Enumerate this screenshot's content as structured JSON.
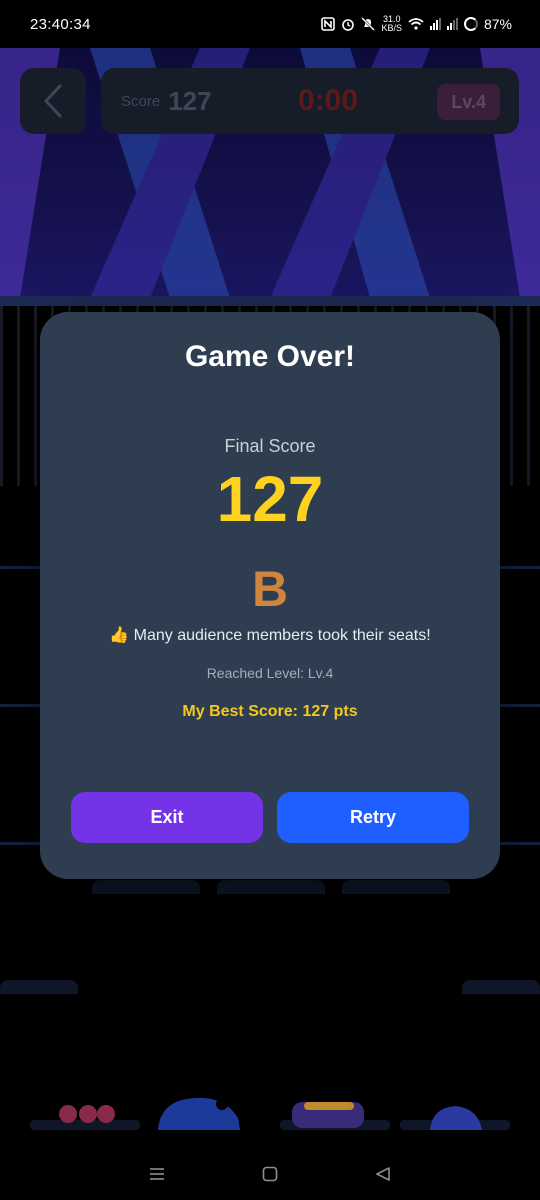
{
  "status_bar": {
    "time": "23:40:34",
    "net_speed_value": "31.0",
    "net_speed_unit": "KB/S",
    "battery": "87%",
    "icons": [
      "nfc-icon",
      "alarm-icon",
      "mute-icon",
      "wifi-icon",
      "signal-icon",
      "signal-icon",
      "battery-icon"
    ]
  },
  "hud": {
    "score_label": "Score",
    "score_value": "127",
    "timer": "0:00",
    "level": "Lv.4"
  },
  "modal": {
    "title": "Game Over!",
    "final_score_label": "Final Score",
    "final_score_value": "127",
    "grade": "B",
    "message": "👍 Many audience members took their seats!",
    "reached_level": "Reached Level: Lv.4",
    "best_score": "My Best Score: 127 pts",
    "exit_label": "Exit",
    "retry_label": "Retry"
  },
  "colors": {
    "modal_bg": "#2e3d4f",
    "score_yellow": "#ffd21f",
    "grade_color": "#cd853f",
    "exit_button": "#7533e8",
    "retry_button": "#1f5fff"
  }
}
